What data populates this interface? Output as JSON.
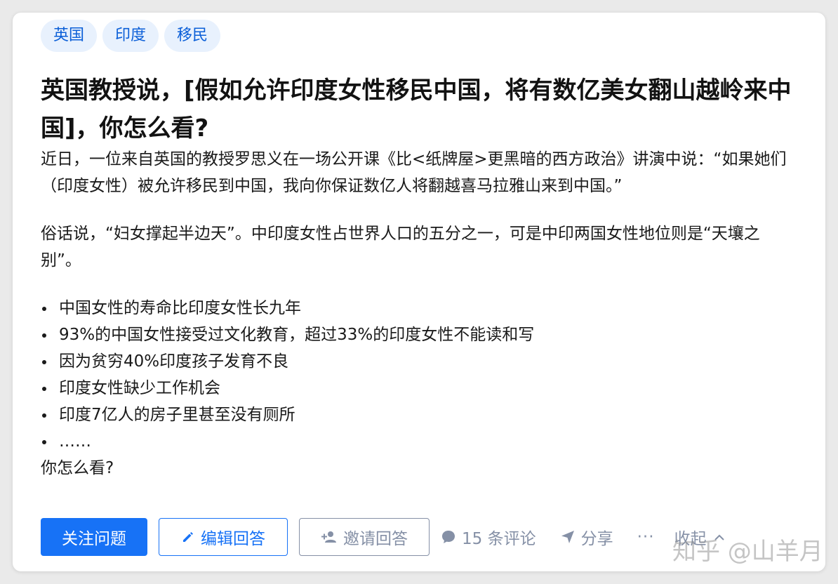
{
  "tags": [
    "英国",
    "印度",
    "移民"
  ],
  "title": "英国教授说，[假如允许印度女性移民中国，将有数亿美女翻山越岭来中国]，你怎么看?",
  "body": {
    "paragraph1": "近日，一位来自英国的教授罗思义在一场公开课《比<纸牌屋>更黑暗的西方政治》讲演中说：“如果她们（印度女性）被允许移民到中国，我向你保证数亿人将翻越喜马拉雅山来到中国。”",
    "paragraph2": "俗话说，“妇女撑起半边天”。中印度女性占世界人口的五分之一，可是中印两国女性地位则是“天壤之别”。",
    "bullets": [
      "中国女性的寿命比印度女性长九年",
      "93%的中国女性接受过文化教育，超过33%的印度女性不能读和写",
      "因为贫穷40%印度孩子发育不良",
      "印度女性缺少工作机会",
      "印度7亿人的房子里甚至没有厕所",
      "……"
    ],
    "question": "你怎么看?"
  },
  "actions": {
    "follow_label": "关注问题",
    "edit_label": "编辑回答",
    "invite_label": "邀请回答",
    "comments_label": "15 条评论",
    "share_label": "分享",
    "more_label": "···",
    "collapse_label": "收起"
  },
  "watermark": "知乎 @山羊月",
  "colors": {
    "accent": "#1772f6",
    "tag_bg": "#e8f1fd",
    "tag_text": "#0b5fd8",
    "muted": "#8590a6"
  },
  "icons": [
    "pencil-icon",
    "add-user-icon",
    "comment-icon",
    "share-icon",
    "chevron-up-icon"
  ]
}
